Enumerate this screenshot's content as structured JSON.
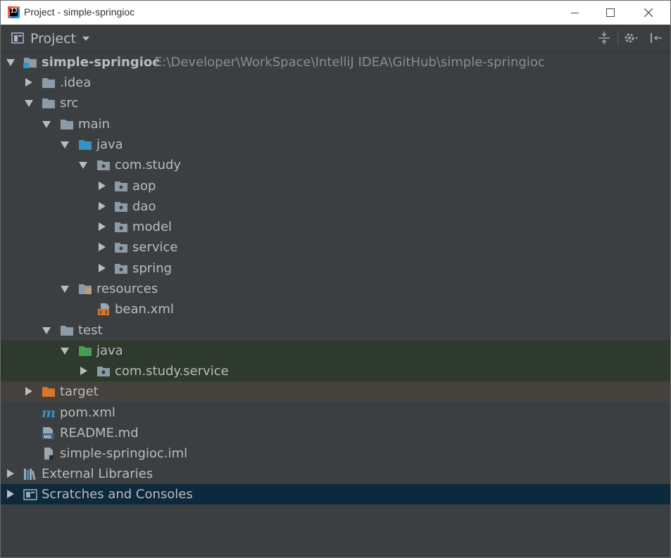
{
  "window": {
    "title": "Project - simple-springioc"
  },
  "toolwindow": {
    "label": "Project"
  },
  "tree": {
    "root": {
      "name": "simple-springioc",
      "path": "E:\\Developer\\WorkSpace\\IntelliJ IDEA\\GitHub\\simple-springioc"
    },
    "idea": ".idea",
    "src": "src",
    "main": "main",
    "main_java": "java",
    "pkg": "com.study",
    "aop": "aop",
    "dao": "dao",
    "model": "model",
    "service": "service",
    "spring": "spring",
    "resources": "resources",
    "bean": "bean.xml",
    "test": "test",
    "test_java": "java",
    "test_pkg": "com.study.service",
    "target": "target",
    "pom": "pom.xml",
    "readme": "README.md",
    "iml": "simple-springioc.iml",
    "ext": "External Libraries",
    "scratches": "Scratches and Consoles"
  },
  "colors": {
    "background": "#3c3f41",
    "folder": "#8c9ba5",
    "source_folder": "#3592c4",
    "test_folder": "#499c54",
    "excluded_folder": "#d9742b",
    "highlight_test": "#2f3a2f",
    "highlight_excluded": "#45413c",
    "highlight_selected": "#0d293e"
  }
}
